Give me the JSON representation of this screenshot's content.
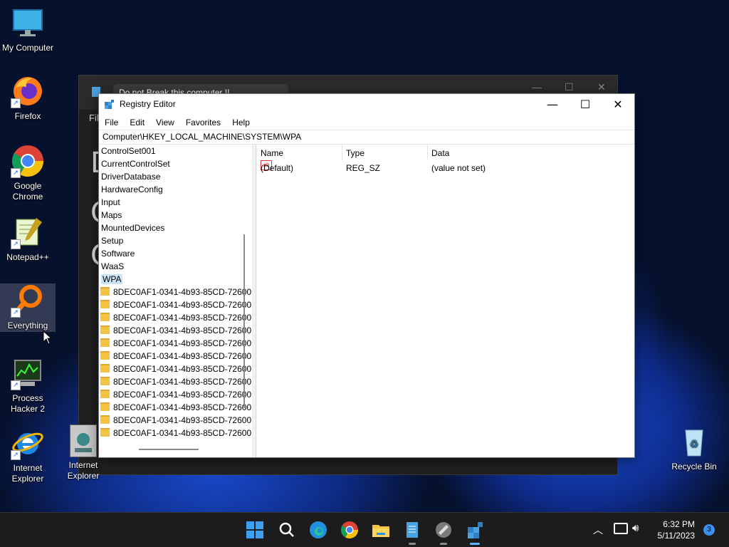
{
  "desktop": {
    "icons": [
      {
        "label": "My Computer",
        "icon": "monitor-icon"
      },
      {
        "label": "Firefox",
        "icon": "firefox-icon"
      },
      {
        "label": "Google Chrome",
        "icon": "chrome-icon"
      },
      {
        "label": "Notepad++",
        "icon": "notepadpp-icon"
      },
      {
        "label": "Everything",
        "icon": "everything-icon"
      },
      {
        "label": "Process Hacker 2",
        "icon": "process-hacker-icon"
      },
      {
        "label": "Internet Explorer",
        "icon": "ie-icon"
      },
      {
        "label": "Internet Explorer",
        "icon": "ie-alt-icon"
      },
      {
        "label": "Recycle Bin",
        "icon": "recycle-bin-icon"
      }
    ]
  },
  "background_window": {
    "tab_title": "Do not Break this computer !!",
    "menu_first": "Fil",
    "letters": [
      "D",
      "C",
      "C"
    ]
  },
  "registry": {
    "title": "Registry Editor",
    "menu": [
      "File",
      "Edit",
      "View",
      "Favorites",
      "Help"
    ],
    "address": "Computer\\HKEY_LOCAL_MACHINE\\SYSTEM\\WPA",
    "tree_nodes": [
      "ControlSet001",
      "CurrentControlSet",
      "DriverDatabase",
      "HardwareConfig",
      "Input",
      "Maps",
      "MountedDevices",
      "Setup",
      "Software",
      "WaaS",
      "WPA"
    ],
    "selected_node": "WPA",
    "child_keys": [
      "8DEC0AF1-0341-4b93-85CD-72600",
      "8DEC0AF1-0341-4b93-85CD-72600",
      "8DEC0AF1-0341-4b93-85CD-72600",
      "8DEC0AF1-0341-4b93-85CD-72600",
      "8DEC0AF1-0341-4b93-85CD-72600",
      "8DEC0AF1-0341-4b93-85CD-72600",
      "8DEC0AF1-0341-4b93-85CD-72600",
      "8DEC0AF1-0341-4b93-85CD-72600",
      "8DEC0AF1-0341-4b93-85CD-72600",
      "8DEC0AF1-0341-4b93-85CD-72600",
      "8DEC0AF1-0341-4b93-85CD-72600",
      "8DEC0AF1-0341-4b93-85CD-72600"
    ],
    "columns": [
      "Name",
      "Type",
      "Data"
    ],
    "values": [
      {
        "name": "(Default)",
        "type": "REG_SZ",
        "data": "(value not set)"
      }
    ]
  },
  "taskbar": {
    "items": [
      "start-icon",
      "search-icon",
      "edge-icon",
      "chrome-icon",
      "file-explorer-icon",
      "notepad-icon",
      "process-hacker-icon",
      "regedit-icon"
    ],
    "time": "6:32 PM",
    "date": "5/11/2023",
    "notification_count": "3"
  }
}
